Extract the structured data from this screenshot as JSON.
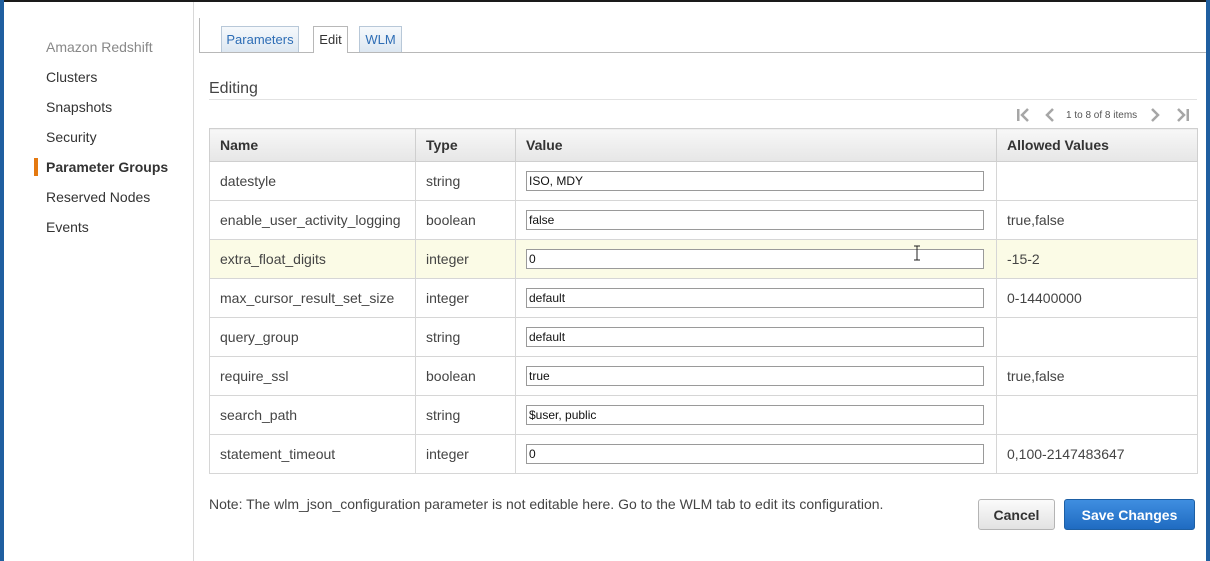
{
  "sidebar": {
    "header": "Amazon Redshift",
    "items": [
      {
        "label": "Clusters"
      },
      {
        "label": "Snapshots"
      },
      {
        "label": "Security"
      },
      {
        "label": "Parameter Groups"
      },
      {
        "label": "Reserved Nodes"
      },
      {
        "label": "Events"
      }
    ],
    "active_item": "Parameter Groups"
  },
  "tabs": [
    {
      "label": "Parameters"
    },
    {
      "label": "Edit"
    },
    {
      "label": "WLM"
    }
  ],
  "active_tab": "Edit",
  "section_title": "Editing",
  "pagination": {
    "text": "1 to 8 of 8 items"
  },
  "table": {
    "columns": [
      "Name",
      "Type",
      "Value",
      "Allowed Values"
    ],
    "rows": [
      {
        "name": "datestyle",
        "type": "string",
        "value": "ISO, MDY",
        "allowed": ""
      },
      {
        "name": "enable_user_activity_logging",
        "type": "boolean",
        "value": "false",
        "allowed": "true,false"
      },
      {
        "name": "extra_float_digits",
        "type": "integer",
        "value": "0",
        "allowed": "-15-2"
      },
      {
        "name": "max_cursor_result_set_size",
        "type": "integer",
        "value": "default",
        "allowed": "0-14400000"
      },
      {
        "name": "query_group",
        "type": "string",
        "value": "default",
        "allowed": ""
      },
      {
        "name": "require_ssl",
        "type": "boolean",
        "value": "true",
        "allowed": "true,false"
      },
      {
        "name": "search_path",
        "type": "string",
        "value": "$user, public",
        "allowed": ""
      },
      {
        "name": "statement_timeout",
        "type": "integer",
        "value": "0",
        "allowed": "0,100-2147483647"
      }
    ],
    "highlighted_row": "extra_float_digits"
  },
  "note": "Note: The wlm_json_configuration parameter is not editable here. Go to the WLM tab to edit its configuration.",
  "buttons": {
    "cancel": "Cancel",
    "save": "Save Changes"
  },
  "colors": {
    "accent_orange": "#e47911",
    "link_blue": "#2d6db5",
    "primary_button": "#1f6bc1",
    "row_highlight": "#fbfbe6"
  }
}
